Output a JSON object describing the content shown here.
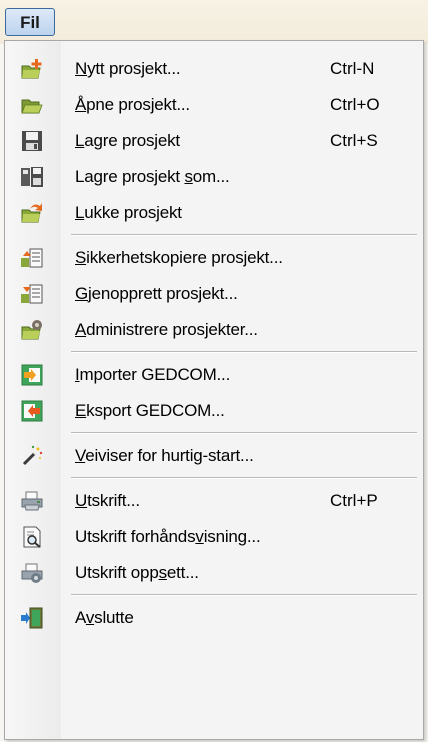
{
  "menubar": {
    "file_menu_label": "Fil"
  },
  "menu": {
    "items": [
      {
        "label": "Nytt prosjekt...",
        "shortcut": "Ctrl-N",
        "icon": "new-project-icon"
      },
      {
        "label": "Åpne prosjekt...",
        "shortcut": "Ctrl+O",
        "icon": "open-project-icon"
      },
      {
        "label": "Lagre prosjekt",
        "shortcut": "Ctrl+S",
        "icon": "save-icon"
      },
      {
        "label": "Lagre prosjekt som...",
        "shortcut": "",
        "icon": "save-as-icon"
      },
      {
        "label": "Lukke prosjekt",
        "shortcut": "",
        "icon": "close-project-icon"
      },
      {
        "label": "Sikkerhetskopiere prosjekt...",
        "shortcut": "",
        "icon": "backup-icon"
      },
      {
        "label": "Gjenopprett prosjekt...",
        "shortcut": "",
        "icon": "restore-icon"
      },
      {
        "label": "Administrere prosjekter...",
        "shortcut": "",
        "icon": "manage-projects-icon"
      },
      {
        "label": "Importer GEDCOM...",
        "shortcut": "",
        "icon": "import-icon"
      },
      {
        "label": "Eksport GEDCOM...",
        "shortcut": "",
        "icon": "export-icon"
      },
      {
        "label": "Veiviser for hurtig-start...",
        "shortcut": "",
        "icon": "wizard-icon"
      },
      {
        "label": "Utskrift...",
        "shortcut": "Ctrl+P",
        "icon": "printer-icon"
      },
      {
        "label": "Utskrift forhåndsvisning...",
        "shortcut": "",
        "icon": "print-preview-icon"
      },
      {
        "label": "Utskrift oppsett...",
        "shortcut": "",
        "icon": "print-setup-icon"
      },
      {
        "label": "Avslutte",
        "shortcut": "",
        "icon": "exit-icon"
      }
    ]
  }
}
